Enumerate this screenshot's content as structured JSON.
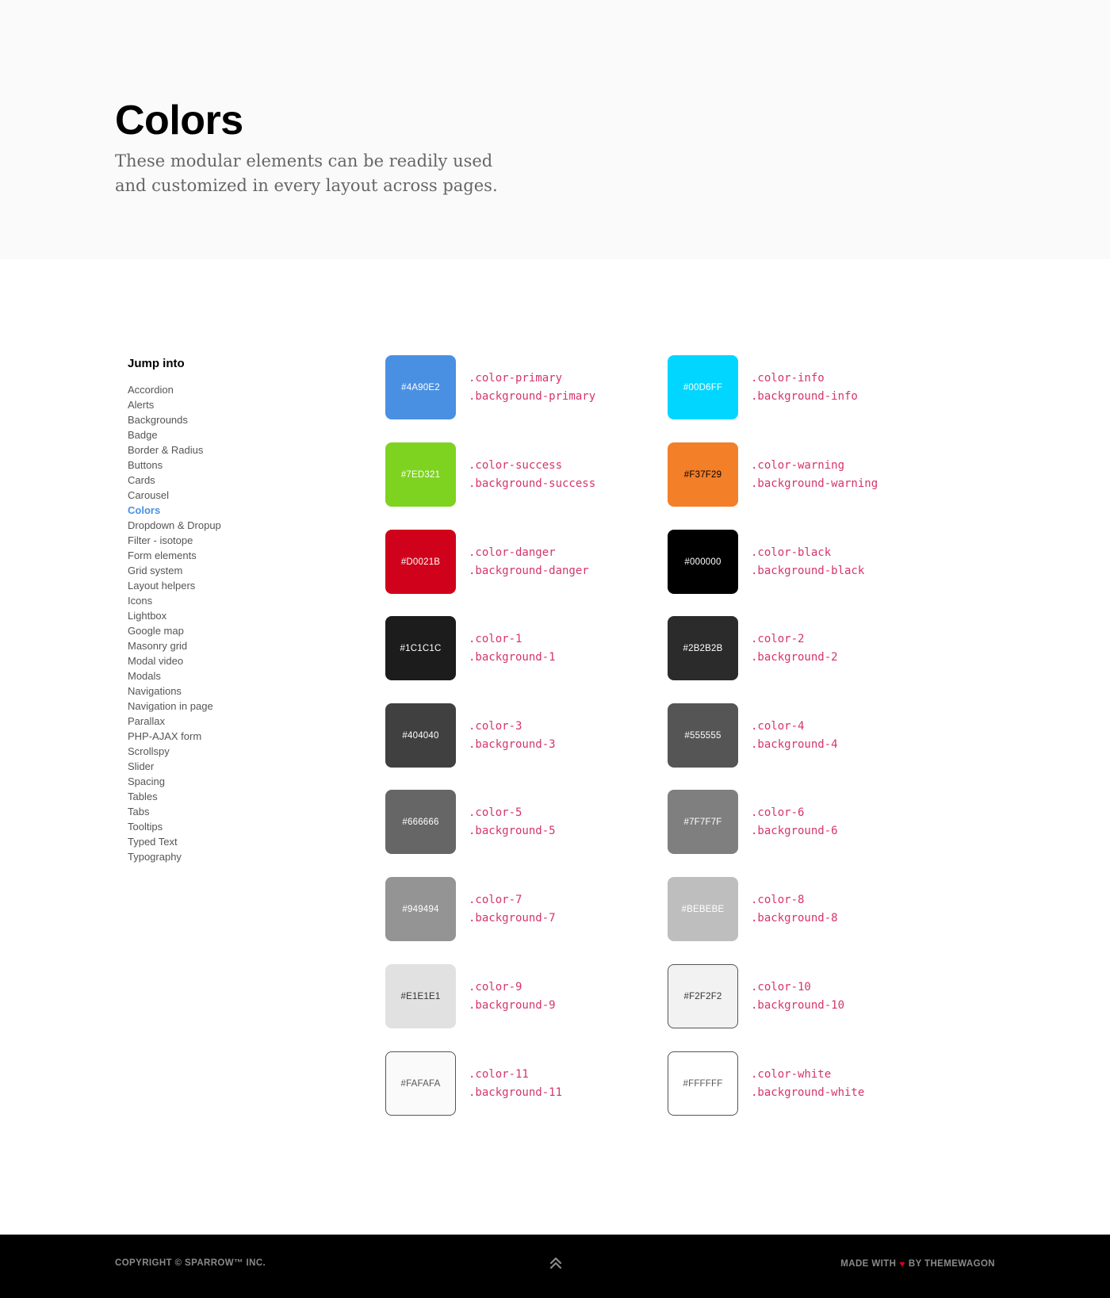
{
  "hero": {
    "title": "Colors",
    "subtitle": "These modular elements can be readily used and customized in every layout across pages."
  },
  "sidebar": {
    "heading": "Jump into",
    "active": "Colors",
    "items": [
      "Accordion",
      "Alerts",
      "Backgrounds",
      "Badge",
      "Border & Radius",
      "Buttons",
      "Cards",
      "Carousel",
      "Colors",
      "Dropdown & Dropup",
      "Filter - isotope",
      "Form elements",
      "Grid system",
      "Layout helpers",
      "Icons",
      "Lightbox",
      "Google map",
      "Masonry grid",
      "Modal video",
      "Modals",
      "Navigations",
      "Navigation in page",
      "Parallax",
      "PHP-AJAX form",
      "Scrollspy",
      "Slider",
      "Spacing",
      "Tables",
      "Tabs",
      "Tooltips",
      "Typed Text",
      "Typography"
    ]
  },
  "swatches": [
    {
      "hex": "#4A90E2",
      "label_color": "#ffffff",
      "bordered": false,
      "color_class": ".color-primary",
      "bg_class": ".background-primary"
    },
    {
      "hex": "#00D6FF",
      "label_color": "#ffffff",
      "bordered": false,
      "color_class": ".color-info",
      "bg_class": ".background-info"
    },
    {
      "hex": "#7ED321",
      "label_color": "#ffffff",
      "bordered": false,
      "color_class": ".color-success",
      "bg_class": ".background-success"
    },
    {
      "hex": "#F37F29",
      "label_color": "#000000",
      "bordered": false,
      "color_class": ".color-warning",
      "bg_class": ".background-warning"
    },
    {
      "hex": "#D0021B",
      "label_color": "#ffffff",
      "bordered": false,
      "color_class": ".color-danger",
      "bg_class": ".background-danger"
    },
    {
      "hex": "#000000",
      "label_color": "#ffffff",
      "bordered": false,
      "color_class": ".color-black",
      "bg_class": ".background-black"
    },
    {
      "hex": "#1C1C1C",
      "label_color": "#ffffff",
      "bordered": false,
      "color_class": ".color-1",
      "bg_class": ".background-1"
    },
    {
      "hex": "#2B2B2B",
      "label_color": "#ffffff",
      "bordered": false,
      "color_class": ".color-2",
      "bg_class": ".background-2"
    },
    {
      "hex": "#404040",
      "label_color": "#ffffff",
      "bordered": false,
      "color_class": ".color-3",
      "bg_class": ".background-3"
    },
    {
      "hex": "#555555",
      "label_color": "#ffffff",
      "bordered": false,
      "color_class": ".color-4",
      "bg_class": ".background-4"
    },
    {
      "hex": "#666666",
      "label_color": "#ffffff",
      "bordered": false,
      "color_class": ".color-5",
      "bg_class": ".background-5"
    },
    {
      "hex": "#7F7F7F",
      "label_color": "#ffffff",
      "bordered": false,
      "color_class": ".color-6",
      "bg_class": ".background-6"
    },
    {
      "hex": "#949494",
      "label_color": "#ffffff",
      "bordered": false,
      "color_class": ".color-7",
      "bg_class": ".background-7"
    },
    {
      "hex": "#BEBEBE",
      "label_color": "#ffffff",
      "bordered": false,
      "color_class": ".color-8",
      "bg_class": ".background-8"
    },
    {
      "hex": "#E1E1E1",
      "label_color": "#333333",
      "bordered": false,
      "color_class": ".color-9",
      "bg_class": ".background-9"
    },
    {
      "hex": "#F2F2F2",
      "label_color": "#333333",
      "bordered": true,
      "color_class": ".color-10",
      "bg_class": ".background-10"
    },
    {
      "hex": "#FAFAFA",
      "label_color": "#555555",
      "bordered": true,
      "color_class": ".color-11",
      "bg_class": ".background-11"
    },
    {
      "hex": "#FFFFFF",
      "label_color": "#555555",
      "bordered": true,
      "color_class": ".color-white",
      "bg_class": ".background-white"
    }
  ],
  "footer": {
    "copyright": "Copyright © Sparrow™ Inc.",
    "made_with": "Made with",
    "by": "by Themewagon"
  }
}
